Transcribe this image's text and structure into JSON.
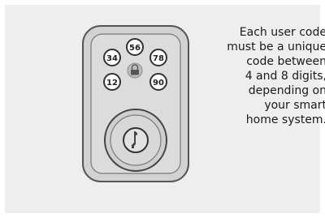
{
  "keypad": {
    "buttons": [
      "56",
      "34",
      "78",
      "12",
      "90"
    ],
    "lock_icon": "padlock-icon",
    "cylinder_icon": "key-cylinder-icon"
  },
  "caption": {
    "lines": [
      "Each user code",
      "must be a unique",
      "code between",
      "4 and 8 digits,",
      "depending on",
      "your smart",
      "home system."
    ]
  },
  "colors": {
    "panel": "#eeeeee",
    "lock_body": "#cfcfcf",
    "lock_outline": "#555555",
    "text": "#1a1a1a"
  }
}
